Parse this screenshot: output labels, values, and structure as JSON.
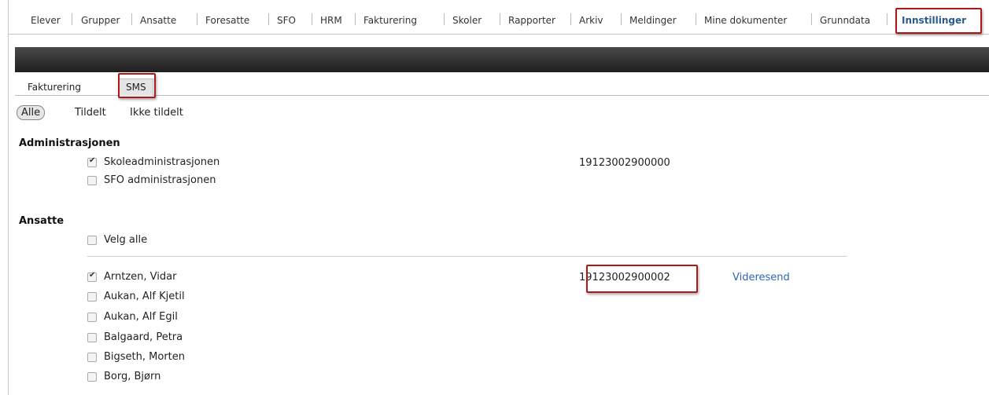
{
  "topnav": {
    "items": [
      "Elever",
      "Grupper",
      "Ansatte",
      "Foresatte",
      "SFO",
      "HRM",
      "Fakturering",
      "Skoler",
      "Rapporter",
      "Arkiv",
      "Meldinger",
      "Mine dokumenter",
      "Grunndata",
      "Innstillinger"
    ],
    "active": "Innstillinger"
  },
  "subtabs": [
    "Fakturering",
    "SMS"
  ],
  "filters": [
    "Alle",
    "Tildelt",
    "Ikke tildelt"
  ],
  "sections": {
    "admin": {
      "title": "Administrasjonen",
      "rows": [
        {
          "label": "Skoleadministrasjonen",
          "checked": true,
          "number": "19123002900000"
        },
        {
          "label": "SFO administrasjonen",
          "checked": false
        }
      ]
    },
    "ansatte": {
      "title": "Ansatte",
      "select_all": "Velg alle",
      "rows": [
        {
          "label": "Arntzen, Vidar",
          "checked": true,
          "number": "19123002900002",
          "action": "Videresend"
        },
        {
          "label": "Aukan, Alf Kjetil",
          "checked": false
        },
        {
          "label": "Aukan, Alf Egil",
          "checked": false
        },
        {
          "label": "Balgaard, Petra",
          "checked": false
        },
        {
          "label": "Bigseth, Morten",
          "checked": false
        },
        {
          "label": "Borg, Bjørn",
          "checked": false
        }
      ]
    }
  }
}
